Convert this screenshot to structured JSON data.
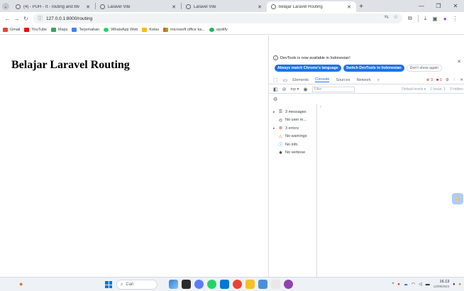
{
  "browser": {
    "tabs": [
      {
        "label": "(4) - PUH - rt - routing and blv",
        "active": false
      },
      {
        "label": "Laravel Vite",
        "active": false
      },
      {
        "label": "Laravel Vite",
        "active": false
      },
      {
        "label": "belajar Laravel Routing",
        "active": true
      }
    ],
    "url": "127.0.0.1:8000/routing",
    "bookmarks": [
      {
        "label": "Gmail",
        "color": "#ea4335"
      },
      {
        "label": "YouTube",
        "color": "#ff0000"
      },
      {
        "label": "Maps",
        "color": "#34a853"
      },
      {
        "label": "Terjemahan",
        "color": "#4285f4"
      },
      {
        "label": "WhatsApp Web",
        "color": "#25d366"
      },
      {
        "label": "Kelas",
        "color": "#fbbc04"
      },
      {
        "label": "microsoft office ka...",
        "color": "#f25022"
      },
      {
        "label": "spotify",
        "color": "#1db954"
      }
    ]
  },
  "page": {
    "heading": "Belajar Laravel Routing"
  },
  "devtools": {
    "notice": "DevTools is now available in Indonesian!",
    "lang_buttons": {
      "match": "Always match Chrome's language",
      "switch": "Switch DevTools to Indonesian",
      "dont_show": "Don't show again"
    },
    "tabs": [
      "Elements",
      "Console",
      "Sources",
      "Network",
      "»"
    ],
    "active_tab": "Console",
    "error_count": "3",
    "issue_count": "1",
    "filter": {
      "context": "top",
      "placeholder": "Filter",
      "levels": "Default levels ▾",
      "issues": "1 Issue: 1",
      "hidden": "3 hidden"
    },
    "sidebar": [
      {
        "label": "3 messages",
        "icon": "list-icon",
        "expandable": true
      },
      {
        "label": "No user m...",
        "icon": "user-icon",
        "expandable": false
      },
      {
        "label": "3 errors",
        "icon": "error-icon",
        "expandable": true
      },
      {
        "label": "No warnings",
        "icon": "warning-icon",
        "expandable": false
      },
      {
        "label": "No info",
        "icon": "info-icon",
        "expandable": false
      },
      {
        "label": "No verbose",
        "icon": "bug-icon",
        "expandable": false
      }
    ]
  },
  "taskbar": {
    "search_placeholder": "Cari",
    "time": "16.13",
    "date": "12/09/2024"
  }
}
